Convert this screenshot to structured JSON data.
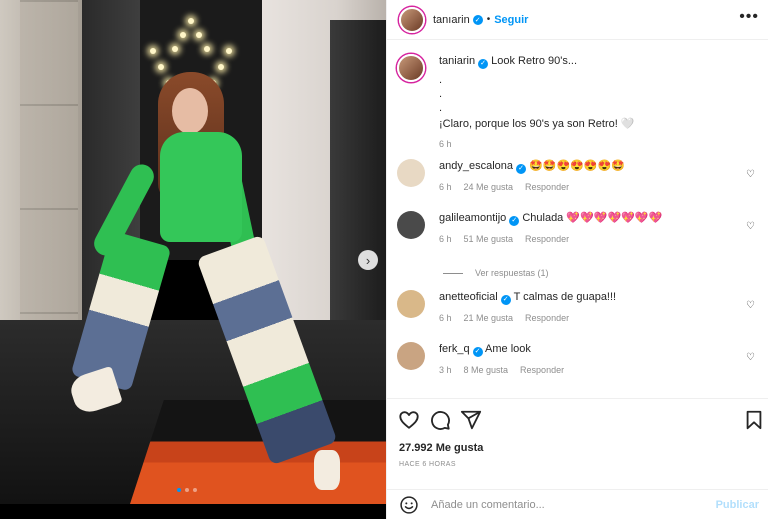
{
  "post": {
    "author": "tanıarin",
    "follow_label": "Seguir",
    "separator": "•",
    "more_label": "•••"
  },
  "caption": {
    "username": "taniarin",
    "title": "Look Retro 90's...",
    "bullets": [
      ".",
      ".",
      "."
    ],
    "body": "¡Claro, porque los 90's ya son Retro! 🤍",
    "time": "6 h"
  },
  "comments": [
    {
      "username": "andy_escalona",
      "text": "🤩🤩😍😍😍😍🤩",
      "time": "6 h",
      "likes": "24 Me gusta",
      "reply": "Responder",
      "avatar_color": "#e8d9c4"
    },
    {
      "username": "galileamontijo",
      "text": "Chulada 💖💖💖💖💖💖💖",
      "time": "6 h",
      "likes": "51 Me gusta",
      "reply": "Responder",
      "avatar_color": "#4a4a4a"
    },
    {
      "username": "anetteoficial",
      "text": "T calmas de guapa!!!",
      "time": "6 h",
      "likes": "21 Me gusta",
      "reply": "Responder",
      "avatar_color": "#d9b889"
    },
    {
      "username": "ferk_q",
      "text": "Ame look",
      "time": "3 h",
      "likes": "8 Me gusta",
      "reply": "Responder",
      "avatar_color": "#c9a482"
    }
  ],
  "view_replies": "Ver respuestas (1)",
  "likes": "27.992 Me gusta",
  "time_ago": "HACE 6 HORAS",
  "comment_box": {
    "placeholder": "Añade un comentario...",
    "publish_label": "Publicar"
  },
  "colors": {
    "accent": "#0095f6",
    "publish_disabled": "#b2dffc",
    "muted": "#8e8e8e"
  },
  "carousel": {
    "slides": 3,
    "active_index": 0
  }
}
